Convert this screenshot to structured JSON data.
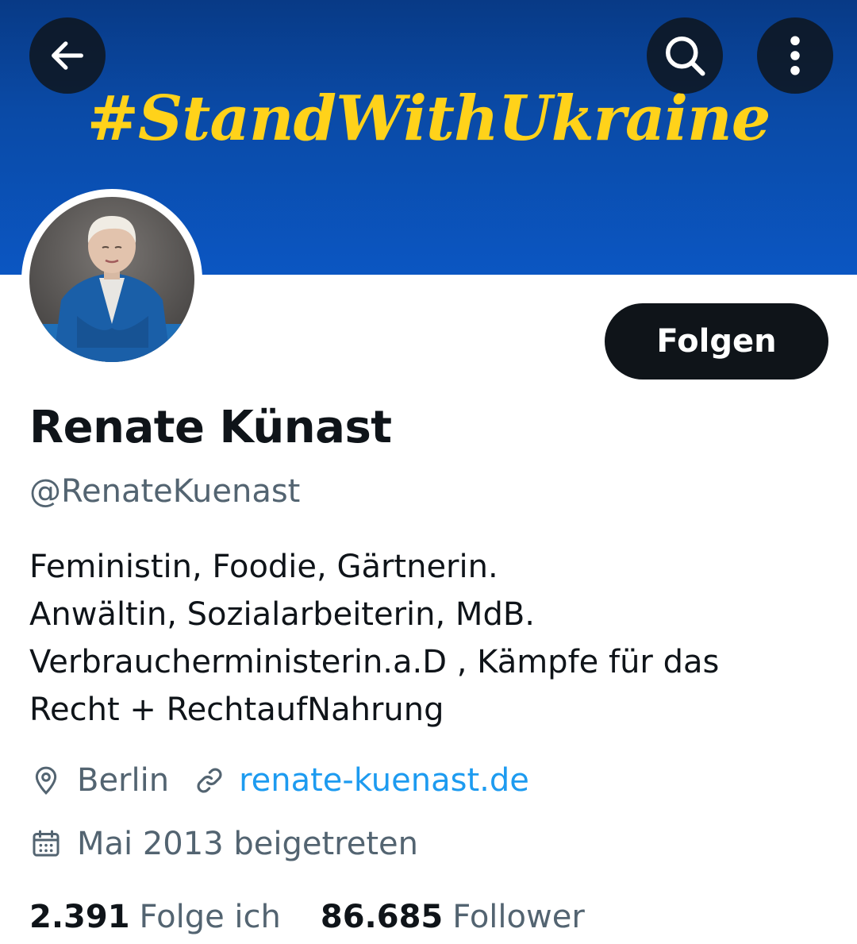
{
  "banner": {
    "text": "#StandWithUkraine",
    "colors": {
      "background": "#0b56c2",
      "text": "#ffd21a"
    }
  },
  "nav": {
    "back_icon": "arrow-left-icon",
    "search_icon": "search-icon",
    "more_icon": "more-vertical-icon"
  },
  "profile": {
    "name": "Renate Künast",
    "handle": "@RenateKuenast",
    "follow_label": "Folgen",
    "bio_lines": [
      "Feministin, Foodie, Gärtnerin.",
      "Anwältin, Sozialarbeiterin, MdB.",
      "Verbraucherministerin.a.D , Kämpfe für das",
      "Recht + RechtaufNahrung"
    ],
    "location": "Berlin",
    "website": "renate-kuenast.de",
    "joined": "Mai 2013 beigetreten"
  },
  "stats": {
    "following_count": "2.391",
    "following_label": "Folge ich",
    "followers_count": "86.685",
    "followers_label": "Follower"
  },
  "colors": {
    "primary_text": "#0f1419",
    "secondary_text": "#536471",
    "link": "#1d9bf0",
    "button_bg": "#0f1419"
  }
}
